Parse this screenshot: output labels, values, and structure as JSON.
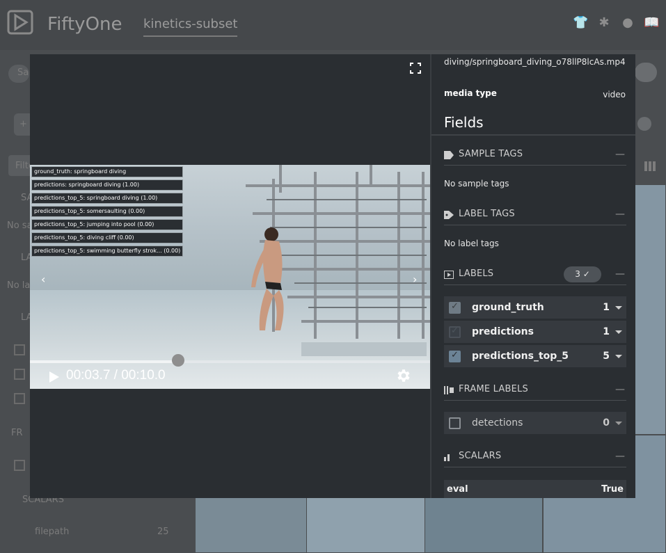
{
  "app": {
    "brand": "FiftyOne",
    "dataset": "kinetics-subset"
  },
  "background": {
    "sidebar_partial": [
      "Sa",
      "+ a",
      "Filte",
      "SA",
      "No sa",
      "LA",
      "No la",
      "LA",
      "FR",
      "SCALARS",
      "filepath",
      "25"
    ]
  },
  "video": {
    "overlay_labels": [
      "ground_truth: springboard diving",
      "predictions: springboard diving (1.00)",
      "predictions_top_5: springboard diving (1.00)",
      "predictions_top_5: somersaulting (0.00)",
      "predictions_top_5: jumping into pool (0.00)",
      "predictions_top_5: diving cliff (0.00)",
      "predictions_top_5: swimming butterfly strok... (0.00)"
    ],
    "timecode": "00:03.7 / 00:10.0",
    "progress_fraction": 0.37
  },
  "sidebar": {
    "filepath_value": "diving/springboard_diving_o78llP8lcAs.mp4",
    "media_type_label": "media type",
    "media_type_value": "video",
    "fields_title": "Fields",
    "sample_tags": {
      "title": "SAMPLE TAGS",
      "empty": "No sample tags"
    },
    "label_tags": {
      "title": "LABEL TAGS",
      "empty": "No label tags"
    },
    "labels": {
      "title": "LABELS",
      "badge": "3",
      "items": [
        {
          "name": "ground_truth",
          "count": "1",
          "state": "checked-dim"
        },
        {
          "name": "predictions",
          "count": "1",
          "state": "dim"
        },
        {
          "name": "predictions_top_5",
          "count": "5",
          "state": "checked"
        }
      ]
    },
    "frame_labels": {
      "title": "FRAME LABELS",
      "items": [
        {
          "name": "detections",
          "count": "0"
        }
      ]
    },
    "scalars": {
      "title": "SCALARS",
      "items": [
        {
          "key": "eval",
          "value": "True"
        }
      ]
    }
  }
}
